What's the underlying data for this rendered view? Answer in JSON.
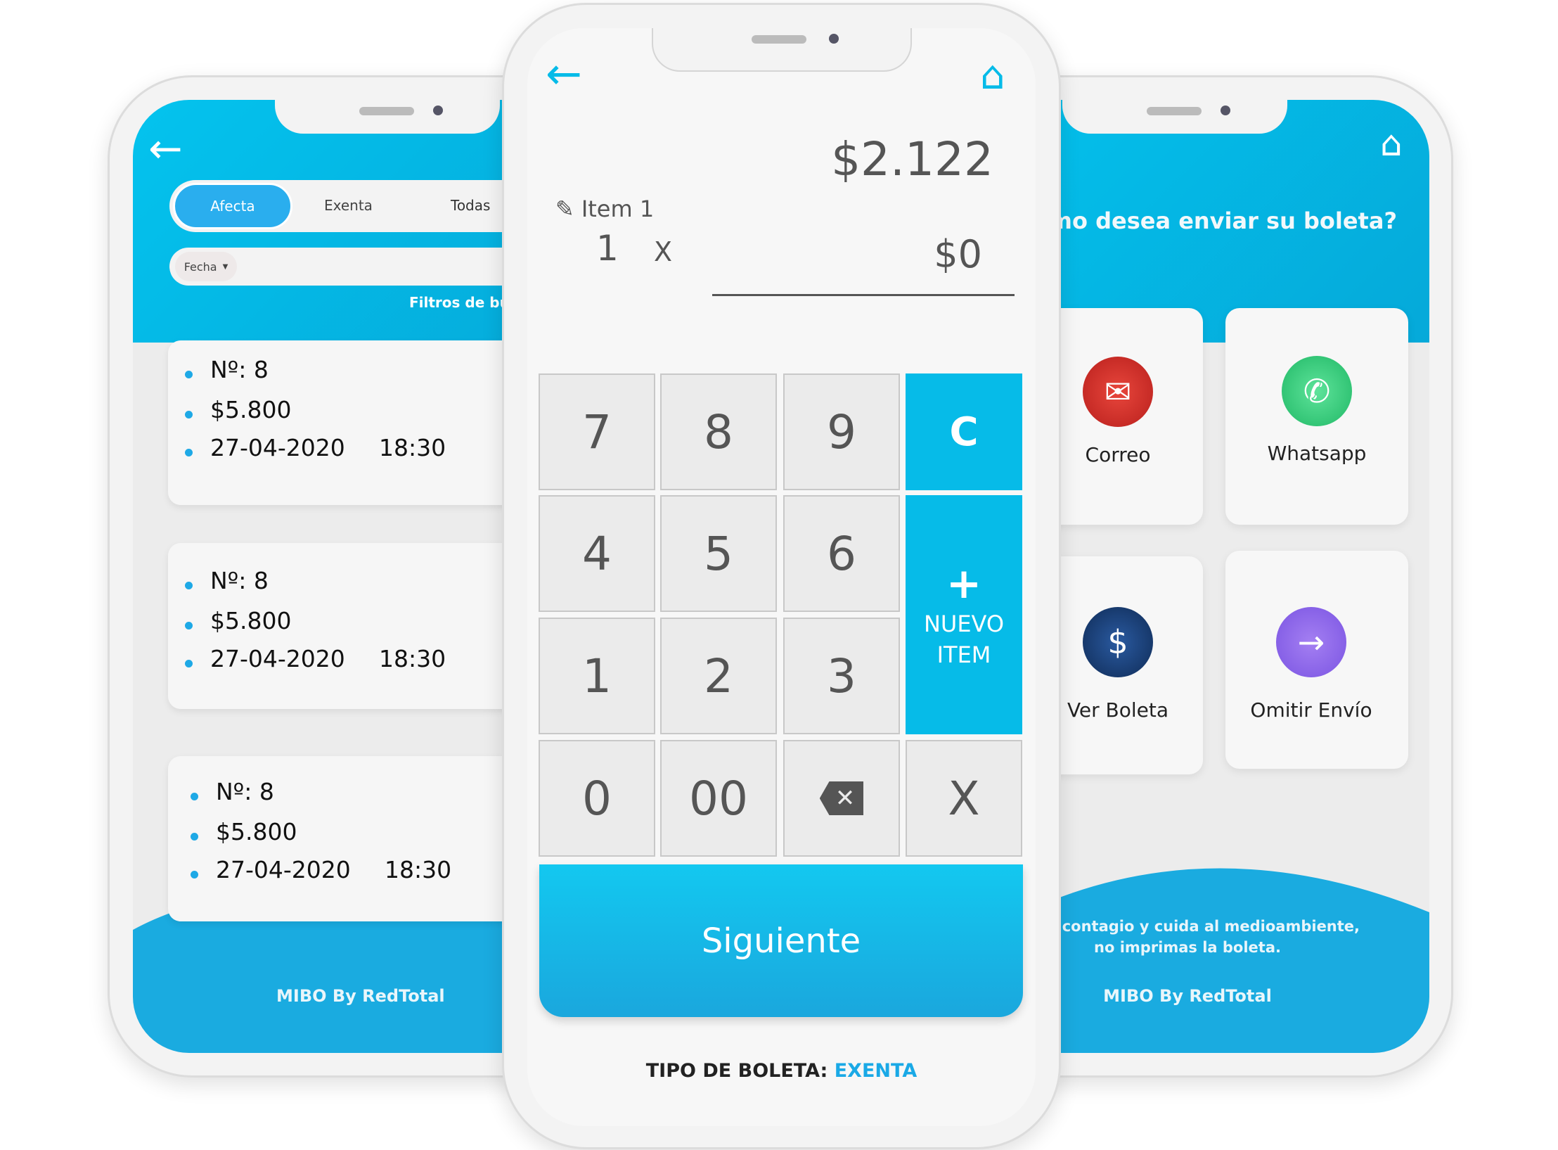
{
  "left": {
    "tabs": [
      "Afecta",
      "Exenta",
      "Todas"
    ],
    "active_tab": "Afecta",
    "filter_chip": "Fecha",
    "filters_link": "Filtros de búsqueda",
    "receipts": [
      {
        "number": "Nº: 8",
        "amount": "$5.800",
        "date": "27-04-2020",
        "time": "18:30"
      },
      {
        "number": "Nº: 8",
        "amount": "$5.800",
        "date": "27-04-2020",
        "time": "18:30"
      },
      {
        "number": "Nº: 8",
        "amount": "$5.800",
        "date": "27-04-2020",
        "time": "18:30"
      }
    ],
    "footer": "MIBO By RedTotal"
  },
  "center": {
    "total": "$2.122",
    "item_label": "Item 1",
    "quantity": "1",
    "times": "X",
    "item_amount": "$0",
    "keys": [
      "7",
      "8",
      "9",
      "C",
      "4",
      "5",
      "6",
      "1",
      "2",
      "3",
      "0",
      "00",
      "X"
    ],
    "new_item_plus": "+",
    "new_item_line1": "NUEVO",
    "new_item_line2": "ITEM",
    "next_button": "Siguiente",
    "type_label": "TIPO DE BOLETA:",
    "type_value": "EXENTA"
  },
  "right": {
    "question": "¿Cómo desea enviar su boleta?",
    "options": [
      "Correo",
      "Whatsapp",
      "Ver Boleta",
      "Omitir Envío"
    ],
    "notice_line1": "Evita contagio y cuida al medioambiente,",
    "notice_line2": "no imprimas la boleta.",
    "footer": "MIBO By RedTotal"
  },
  "colors": {
    "primary": "#04bdea",
    "correo": "#d9302a",
    "whatsapp": "#2fd27a",
    "ver_boleta": "#1d3f7a",
    "omitir": "#8a63e8"
  }
}
